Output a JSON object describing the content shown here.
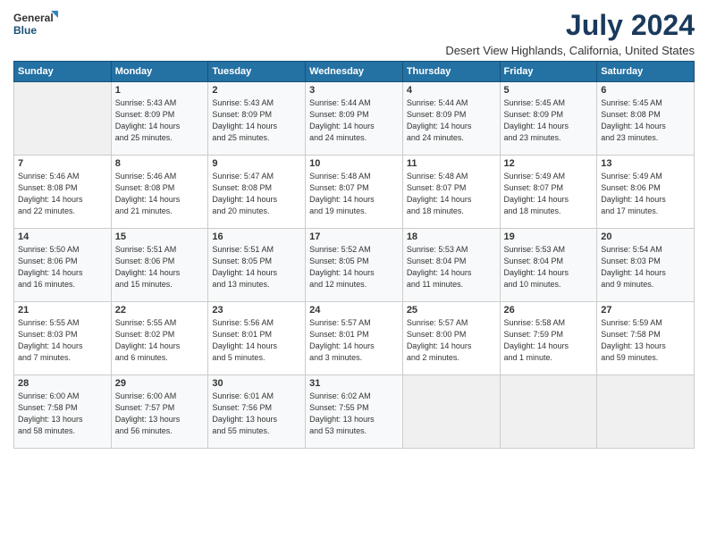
{
  "header": {
    "logo_line1": "General",
    "logo_line2": "Blue",
    "month_title": "July 2024",
    "location": "Desert View Highlands, California, United States"
  },
  "weekdays": [
    "Sunday",
    "Monday",
    "Tuesday",
    "Wednesday",
    "Thursday",
    "Friday",
    "Saturday"
  ],
  "weeks": [
    [
      {
        "day": "",
        "info": ""
      },
      {
        "day": "1",
        "info": "Sunrise: 5:43 AM\nSunset: 8:09 PM\nDaylight: 14 hours\nand 25 minutes."
      },
      {
        "day": "2",
        "info": "Sunrise: 5:43 AM\nSunset: 8:09 PM\nDaylight: 14 hours\nand 25 minutes."
      },
      {
        "day": "3",
        "info": "Sunrise: 5:44 AM\nSunset: 8:09 PM\nDaylight: 14 hours\nand 24 minutes."
      },
      {
        "day": "4",
        "info": "Sunrise: 5:44 AM\nSunset: 8:09 PM\nDaylight: 14 hours\nand 24 minutes."
      },
      {
        "day": "5",
        "info": "Sunrise: 5:45 AM\nSunset: 8:09 PM\nDaylight: 14 hours\nand 23 minutes."
      },
      {
        "day": "6",
        "info": "Sunrise: 5:45 AM\nSunset: 8:08 PM\nDaylight: 14 hours\nand 23 minutes."
      }
    ],
    [
      {
        "day": "7",
        "info": "Sunrise: 5:46 AM\nSunset: 8:08 PM\nDaylight: 14 hours\nand 22 minutes."
      },
      {
        "day": "8",
        "info": "Sunrise: 5:46 AM\nSunset: 8:08 PM\nDaylight: 14 hours\nand 21 minutes."
      },
      {
        "day": "9",
        "info": "Sunrise: 5:47 AM\nSunset: 8:08 PM\nDaylight: 14 hours\nand 20 minutes."
      },
      {
        "day": "10",
        "info": "Sunrise: 5:48 AM\nSunset: 8:07 PM\nDaylight: 14 hours\nand 19 minutes."
      },
      {
        "day": "11",
        "info": "Sunrise: 5:48 AM\nSunset: 8:07 PM\nDaylight: 14 hours\nand 18 minutes."
      },
      {
        "day": "12",
        "info": "Sunrise: 5:49 AM\nSunset: 8:07 PM\nDaylight: 14 hours\nand 18 minutes."
      },
      {
        "day": "13",
        "info": "Sunrise: 5:49 AM\nSunset: 8:06 PM\nDaylight: 14 hours\nand 17 minutes."
      }
    ],
    [
      {
        "day": "14",
        "info": "Sunrise: 5:50 AM\nSunset: 8:06 PM\nDaylight: 14 hours\nand 16 minutes."
      },
      {
        "day": "15",
        "info": "Sunrise: 5:51 AM\nSunset: 8:06 PM\nDaylight: 14 hours\nand 15 minutes."
      },
      {
        "day": "16",
        "info": "Sunrise: 5:51 AM\nSunset: 8:05 PM\nDaylight: 14 hours\nand 13 minutes."
      },
      {
        "day": "17",
        "info": "Sunrise: 5:52 AM\nSunset: 8:05 PM\nDaylight: 14 hours\nand 12 minutes."
      },
      {
        "day": "18",
        "info": "Sunrise: 5:53 AM\nSunset: 8:04 PM\nDaylight: 14 hours\nand 11 minutes."
      },
      {
        "day": "19",
        "info": "Sunrise: 5:53 AM\nSunset: 8:04 PM\nDaylight: 14 hours\nand 10 minutes."
      },
      {
        "day": "20",
        "info": "Sunrise: 5:54 AM\nSunset: 8:03 PM\nDaylight: 14 hours\nand 9 minutes."
      }
    ],
    [
      {
        "day": "21",
        "info": "Sunrise: 5:55 AM\nSunset: 8:03 PM\nDaylight: 14 hours\nand 7 minutes."
      },
      {
        "day": "22",
        "info": "Sunrise: 5:55 AM\nSunset: 8:02 PM\nDaylight: 14 hours\nand 6 minutes."
      },
      {
        "day": "23",
        "info": "Sunrise: 5:56 AM\nSunset: 8:01 PM\nDaylight: 14 hours\nand 5 minutes."
      },
      {
        "day": "24",
        "info": "Sunrise: 5:57 AM\nSunset: 8:01 PM\nDaylight: 14 hours\nand 3 minutes."
      },
      {
        "day": "25",
        "info": "Sunrise: 5:57 AM\nSunset: 8:00 PM\nDaylight: 14 hours\nand 2 minutes."
      },
      {
        "day": "26",
        "info": "Sunrise: 5:58 AM\nSunset: 7:59 PM\nDaylight: 14 hours\nand 1 minute."
      },
      {
        "day": "27",
        "info": "Sunrise: 5:59 AM\nSunset: 7:58 PM\nDaylight: 13 hours\nand 59 minutes."
      }
    ],
    [
      {
        "day": "28",
        "info": "Sunrise: 6:00 AM\nSunset: 7:58 PM\nDaylight: 13 hours\nand 58 minutes."
      },
      {
        "day": "29",
        "info": "Sunrise: 6:00 AM\nSunset: 7:57 PM\nDaylight: 13 hours\nand 56 minutes."
      },
      {
        "day": "30",
        "info": "Sunrise: 6:01 AM\nSunset: 7:56 PM\nDaylight: 13 hours\nand 55 minutes."
      },
      {
        "day": "31",
        "info": "Sunrise: 6:02 AM\nSunset: 7:55 PM\nDaylight: 13 hours\nand 53 minutes."
      },
      {
        "day": "",
        "info": ""
      },
      {
        "day": "",
        "info": ""
      },
      {
        "day": "",
        "info": ""
      }
    ]
  ]
}
